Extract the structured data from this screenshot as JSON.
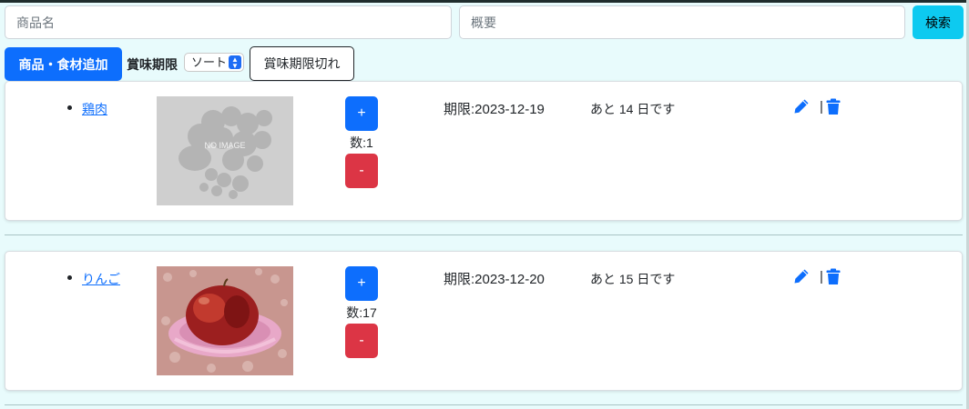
{
  "search": {
    "name_placeholder": "商品名",
    "summary_placeholder": "概要",
    "button_label": "検索"
  },
  "toolbar": {
    "add_label": "商品・食材追加",
    "sort_label": "賞味期限",
    "sort_selected": "ソート",
    "expired_label": "賞味期限切れ"
  },
  "items": [
    {
      "name": "鶏肉",
      "image_text": "NO IMAGE",
      "plus": "+",
      "quantity": "数:1",
      "minus": "-",
      "expiry": "期限:2023-12-19",
      "remaining": "あと 14 日です",
      "separator": "|"
    },
    {
      "name": "りんご",
      "plus": "+",
      "quantity": "数:17",
      "minus": "-",
      "expiry": "期限:2023-12-20",
      "remaining": "あと 15 日です",
      "separator": "|"
    }
  ],
  "colors": {
    "background": "#e8fbfc",
    "primary": "#0d6efd",
    "danger": "#dc3545",
    "info": "#0dcaf0"
  }
}
